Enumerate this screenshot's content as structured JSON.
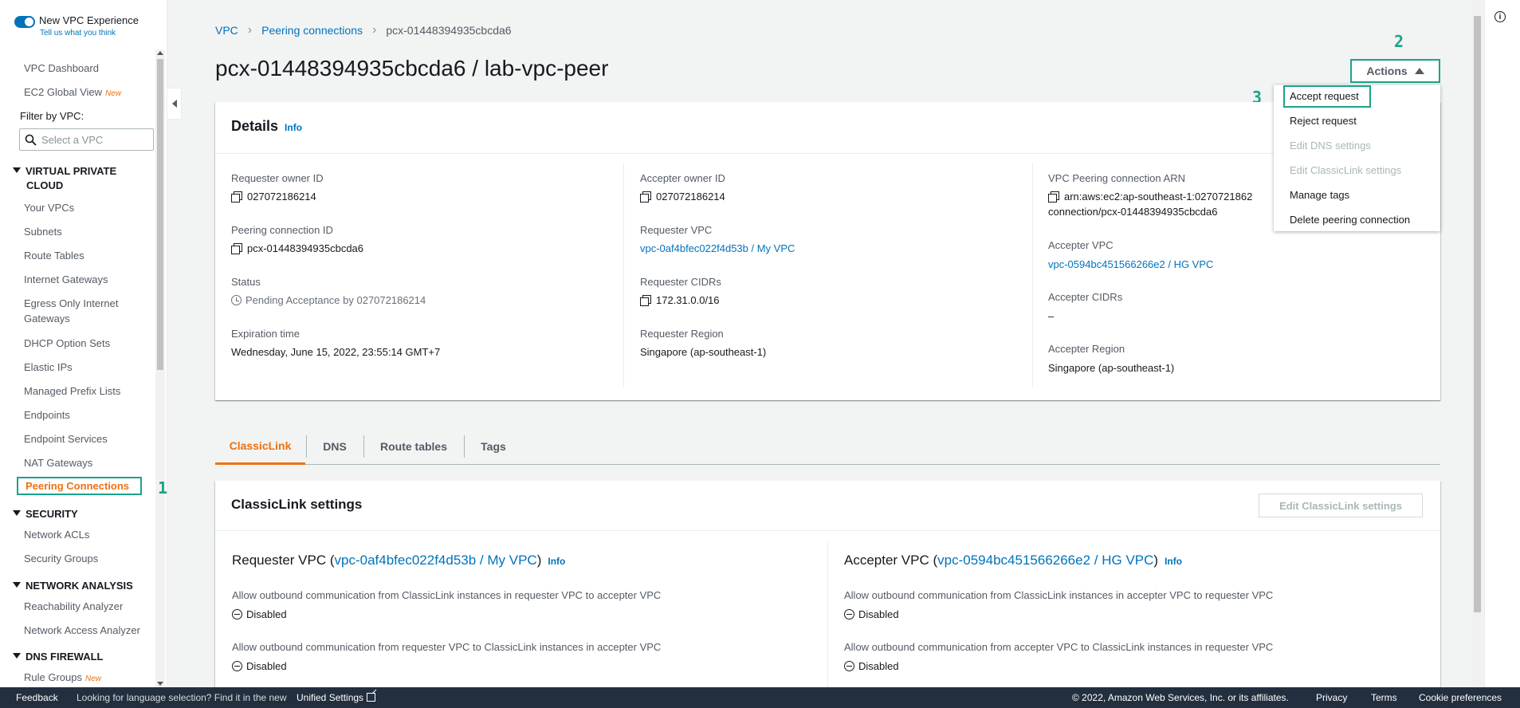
{
  "sidebar": {
    "toggle_title": "New VPC Experience",
    "toggle_sub": "Tell us what you think",
    "filter_label": "Filter by VPC:",
    "filter_placeholder": "Select a VPC",
    "new_badge": "New",
    "items_top": [
      "VPC Dashboard",
      "EC2 Global View"
    ],
    "section_vpc": "VIRTUAL PRIVATE",
    "section_vpc2": "CLOUD",
    "vpc_items": [
      "Your VPCs",
      "Subnets",
      "Route Tables",
      "Internet Gateways",
      "Egress Only Internet",
      "Gateways",
      "DHCP Option Sets",
      "Elastic IPs",
      "Managed Prefix Lists",
      "Endpoints",
      "Endpoint Services",
      "NAT Gateways"
    ],
    "active_item": "Peering Connections",
    "section_security": "SECURITY",
    "security_items": [
      "Network ACLs",
      "Security Groups"
    ],
    "section_network": "NETWORK ANALYSIS",
    "network_items": [
      "Reachability Analyzer",
      "Network Access Analyzer"
    ],
    "section_dns": "DNS FIREWALL",
    "dns_items": [
      "Rule Groups"
    ]
  },
  "annotations": {
    "one": "1",
    "two": "2",
    "three": "3"
  },
  "breadcrumb": {
    "root": "VPC",
    "parent": "Peering connections",
    "current": "pcx-01448394935cbcda6"
  },
  "page_title": "pcx-01448394935cbcda6 / lab-vpc-peer",
  "actions_label": "Actions",
  "dropdown": [
    "Accept request",
    "Reject request",
    "Edit DNS settings",
    "Edit ClassicLink settings",
    "Manage tags",
    "Delete peering connection"
  ],
  "details": {
    "title": "Details",
    "info": "Info",
    "col1": [
      {
        "label": "Requester owner ID",
        "value": "027072186214"
      },
      {
        "label": "Peering connection ID",
        "value": "pcx-01448394935cbcda6"
      },
      {
        "label": "Status",
        "value": "Pending Acceptance by 027072186214"
      },
      {
        "label": "Expiration time",
        "value": "Wednesday, June 15, 2022, 23:55:14 GMT+7"
      }
    ],
    "col2": [
      {
        "label": "Accepter owner ID",
        "value": "027072186214"
      },
      {
        "label": "Requester VPC",
        "value": "vpc-0af4bfec022f4d53b / My VPC"
      },
      {
        "label": "Requester CIDRs",
        "value": "172.31.0.0/16"
      },
      {
        "label": "Requester Region",
        "value": "Singapore (ap-southeast-1)"
      }
    ],
    "col3": [
      {
        "label": "VPC Peering connection ARN",
        "value": "arn:aws:ec2:ap-southeast-1:0270721862",
        "value2": "connection/pcx-01448394935cbcda6"
      },
      {
        "label": "Accepter VPC",
        "value": "vpc-0594bc451566266e2 / HG VPC"
      },
      {
        "label": "Accepter CIDRs",
        "value": "–"
      },
      {
        "label": "Accepter Region",
        "value": "Singapore (ap-southeast-1)"
      }
    ]
  },
  "tabs": [
    "ClassicLink",
    "DNS",
    "Route tables",
    "Tags"
  ],
  "classiclink": {
    "title": "ClassicLink settings",
    "edit_button": "Edit ClassicLink settings",
    "info": "Info",
    "requester_prefix": "Requester VPC (",
    "requester_link": "vpc-0af4bfec022f4d53b / My VPC",
    "accepter_prefix": "Accepter VPC (",
    "accepter_link": "vpc-0594bc451566266e2 / HG VPC",
    "close_paren": ")",
    "requester_rows": [
      {
        "label": "Allow outbound communication from ClassicLink instances in requester VPC to accepter VPC",
        "value": "Disabled"
      },
      {
        "label": "Allow outbound communication from requester VPC to ClassicLink instances in accepter VPC",
        "value": "Disabled"
      }
    ],
    "accepter_rows": [
      {
        "label": "Allow outbound communication from ClassicLink instances in accepter VPC to requester VPC",
        "value": "Disabled"
      },
      {
        "label": "Allow outbound communication from accepter VPC to ClassicLink instances in requester VPC",
        "value": "Disabled"
      }
    ]
  },
  "footer": {
    "feedback": "Feedback",
    "language": "Looking for language selection? Find it in the new",
    "unified": "Unified Settings",
    "copyright": "© 2022, Amazon Web Services, Inc. or its affiliates.",
    "privacy": "Privacy",
    "terms": "Terms",
    "cookie": "Cookie preferences"
  },
  "colors": {
    "accent_link": "#0073bb",
    "active_orange": "#ec7211",
    "annotation_green": "#1aa38b",
    "footer_bg": "#232f3e"
  }
}
